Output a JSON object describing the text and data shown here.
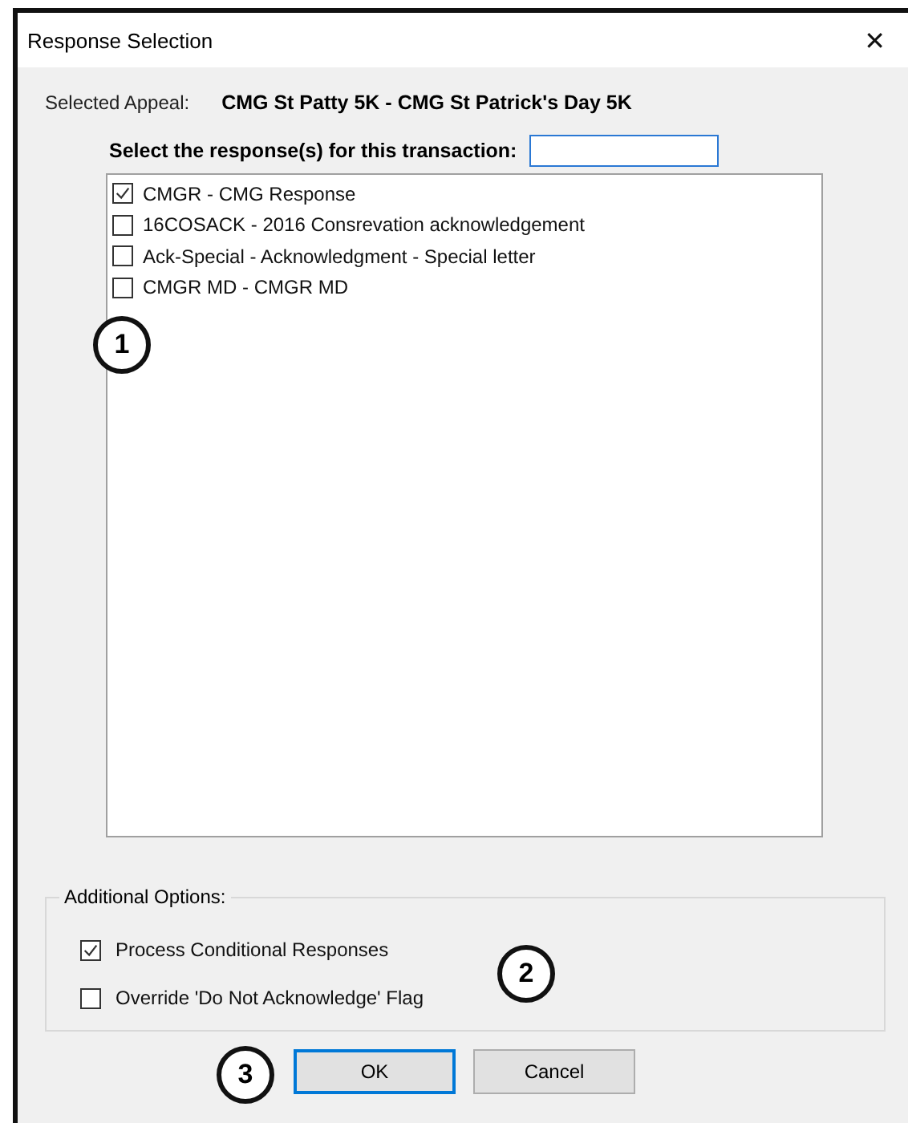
{
  "window": {
    "title": "Response Selection",
    "close": "✕"
  },
  "appeal": {
    "label": "Selected Appeal:",
    "value": "CMG St Patty 5K - CMG St Patrick's Day 5K"
  },
  "filter": {
    "label": "Select the response(s) for this transaction:"
  },
  "responses": [
    {
      "label": "CMGR - CMG Response",
      "checked": true
    },
    {
      "label": "16COSACK - 2016 Consrevation acknowledgement",
      "checked": false
    },
    {
      "label": "Ack-Special - Acknowledgment - Special letter",
      "checked": false
    },
    {
      "label": "CMGR MD - CMGR MD",
      "checked": false
    }
  ],
  "additional_options": {
    "title": "Additional Options:",
    "options": [
      {
        "label": "Process Conditional Responses",
        "checked": true
      },
      {
        "label": "Override 'Do Not Acknowledge' Flag",
        "checked": false
      }
    ]
  },
  "buttons": [
    {
      "label": "OK",
      "selected": true
    },
    {
      "label": "Cancel",
      "selected": false
    }
  ],
  "callouts": [
    "1",
    "2",
    "3"
  ]
}
